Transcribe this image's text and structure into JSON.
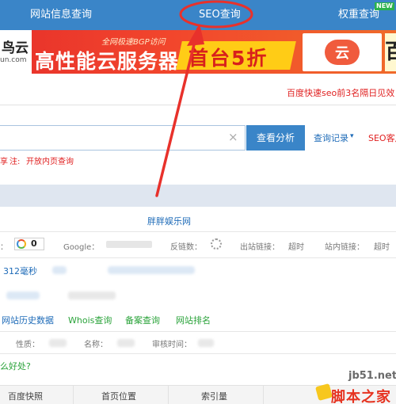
{
  "nav": {
    "tabs": [
      {
        "label": "网站信息查询"
      },
      {
        "label": "SEO查询"
      },
      {
        "label": "权重查询"
      }
    ],
    "new_badge": "NEW"
  },
  "banner": {
    "logo_main": "鸟云",
    "logo_sub": "un.com",
    "tagline": "全网极速BGP访问",
    "headline": "高性能云服务器",
    "promo": "首台5折",
    "icon_mark": "云",
    "edge_char": "百"
  },
  "notice": "百度快速seo前3名隔日见效",
  "search": {
    "clear_icon": "×",
    "button": "查看分析",
    "history": "查询记录",
    "history_arrow": "▾",
    "seo_client": "SEO客户"
  },
  "hint": {
    "prefix": "享",
    "label": "注:",
    "text": "开放内页查询"
  },
  "site": {
    "title": "胖胖娱乐网"
  },
  "metrics": [
    {
      "label": "：",
      "value": "0"
    },
    {
      "label": "Google："
    },
    {
      "label": "反链数："
    },
    {
      "label": "出站链接：",
      "value": "超时"
    },
    {
      "label": "站内链接：",
      "value": "超时"
    }
  ],
  "response_time": "312毫秒",
  "links": [
    {
      "label": "网站历史数据"
    },
    {
      "label": "Whois查询"
    },
    {
      "label": "备案查询"
    },
    {
      "label": "网站排名"
    }
  ],
  "attrs": [
    {
      "label": "性质："
    },
    {
      "label": "名称："
    },
    {
      "label": "审核时间："
    }
  ],
  "benefit": "么好处?",
  "table": {
    "headers": [
      "百度快照",
      "首页位置",
      "索引量"
    ]
  },
  "watermark": {
    "url": "jb51.net",
    "logo": "脚本之家"
  },
  "colors": {
    "nav_bg": "#3a85c8",
    "accent_red": "#e02020",
    "link_blue": "#1e6bb8",
    "link_green": "#2aa33a"
  }
}
